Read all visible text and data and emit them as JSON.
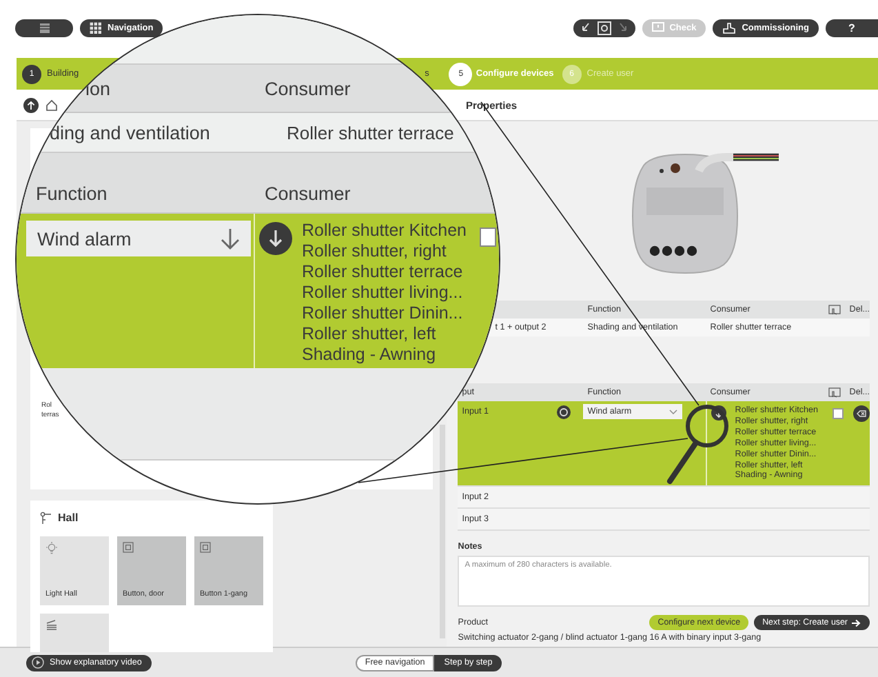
{
  "toolbar": {
    "navigation_label": "Navigation",
    "check_label": "Check",
    "check_disabled": true,
    "commissioning_label": "Commissioning",
    "help_label": "?"
  },
  "steps": [
    {
      "number": "1",
      "label": "Building",
      "completed": true,
      "selected": false
    },
    {
      "label": "s",
      "completed": true,
      "selected": false
    },
    {
      "number": "5",
      "label": "Configure devices",
      "completed": false,
      "selected": true
    },
    {
      "number": "6",
      "label": "Create user",
      "completed": false,
      "selected": false
    }
  ],
  "properties_title": "Properties",
  "room_tile": {
    "lines": [
      "Rol",
      "terras"
    ]
  },
  "hall": {
    "title": "Hall",
    "tiles": [
      {
        "label": "Light Hall",
        "kind": "light",
        "selected": false
      },
      {
        "label": "Button, door",
        "kind": "button",
        "selected": true
      },
      {
        "label": "Button 1-gang",
        "kind": "button",
        "selected": true
      },
      {
        "kind": "blind",
        "selected": false
      }
    ]
  },
  "outputs_table": {
    "columns": [
      "Function",
      "Consumer",
      "Del..."
    ],
    "rows": [
      {
        "input": "t 1 + output 2",
        "function": "Shading and ventilation",
        "consumer": "Roller shutter terrace"
      }
    ]
  },
  "inputs_table": {
    "columns": [
      "put",
      "Function",
      "Consumer",
      "Del..."
    ],
    "rows": [
      {
        "input": "Input 1",
        "selected": true,
        "function": "Wind alarm",
        "checked": false,
        "consumers": [
          "Roller shutter Kitchen",
          "Roller shutter, right",
          "Roller shutter terrace",
          "Roller shutter living...",
          "Roller shutter Dinin...",
          "Roller shutter, left",
          "Shading - Awning"
        ]
      },
      {
        "input": "Input 2",
        "selected": false
      },
      {
        "input": "Input 3",
        "selected": false
      }
    ]
  },
  "notes": {
    "label": "Notes",
    "placeholder": "A maximum of 280 characters is available."
  },
  "product": {
    "label": "Product",
    "value": "Switching actuator 2-gang / blind actuator 1-gang 16 A with binary input 3-gang"
  },
  "actions": {
    "configure_next": "Configure next device",
    "next_step": "Next step: Create user"
  },
  "footer": {
    "video_label": "Show explanatory video",
    "modes": [
      {
        "label": "Free navigation",
        "selected": false
      },
      {
        "label": "Step by step",
        "selected": true
      }
    ]
  },
  "magnifier": {
    "header_top": [
      "ion",
      "Consumer"
    ],
    "row": [
      "ding and ventilation",
      "Roller shutter terrace"
    ],
    "header": [
      "Function",
      "Consumer"
    ],
    "function": "Wind alarm",
    "checked": false,
    "consumers": [
      "Roller shutter Kitchen",
      "Roller shutter, right",
      "Roller shutter terrace",
      "Roller shutter living...",
      "Roller shutter Dinin...",
      "Roller shutter, left",
      "Shading - Awning"
    ]
  }
}
